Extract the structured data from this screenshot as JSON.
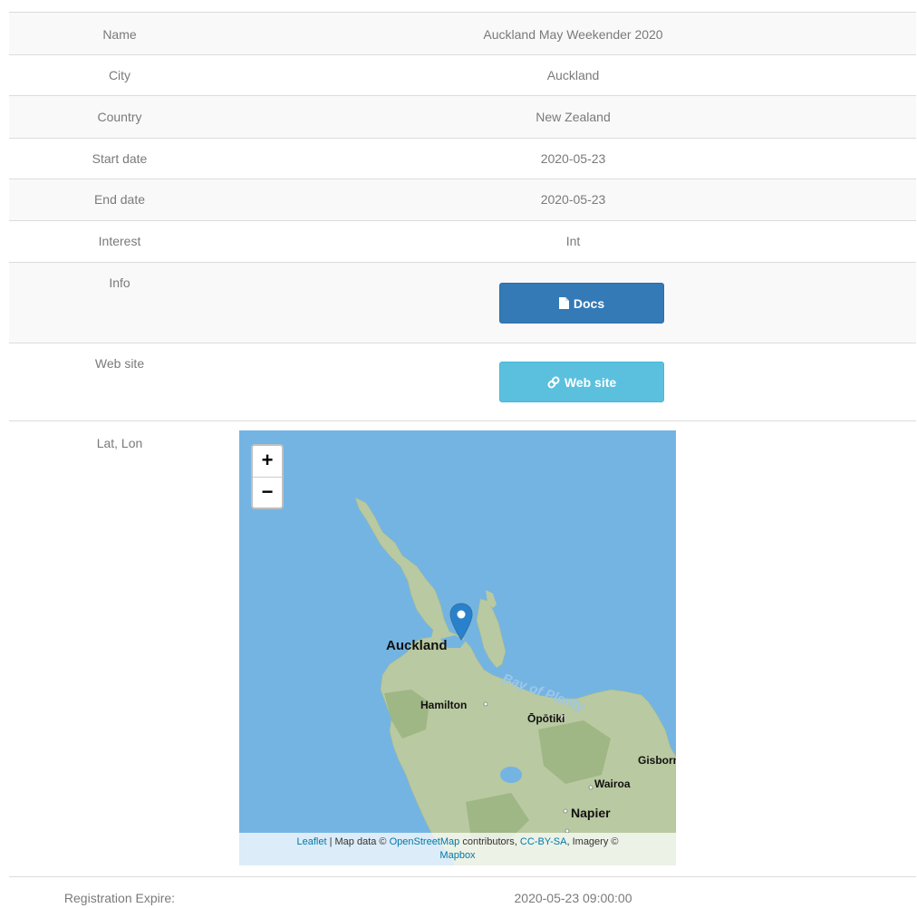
{
  "rows": [
    {
      "label": "Name",
      "value": "Auckland May Weekender 2020"
    },
    {
      "label": "City",
      "value": "Auckland"
    },
    {
      "label": "Country",
      "value": "New Zealand"
    },
    {
      "label": "Start date",
      "value": "2020-05-23"
    },
    {
      "label": "End date",
      "value": "2020-05-23"
    },
    {
      "label": "Interest",
      "value": "Int"
    }
  ],
  "info": {
    "label": "Info",
    "button": "Docs",
    "icon": "document-icon"
  },
  "website": {
    "label": "Web site",
    "button": "Web site",
    "icon": "link-icon"
  },
  "latlon": {
    "label": "Lat, Lon"
  },
  "map": {
    "zoom_in": "+",
    "zoom_out": "−",
    "cities": [
      "Auckland",
      "Hamilton",
      "Ōpōtiki",
      "Gisborne",
      "Wairoa",
      "Napier"
    ],
    "sea_label": "Bay of Plenty",
    "attribution": {
      "leaflet": "Leaflet",
      "map_data": "| Map data ©",
      "osm": "OpenStreetMap",
      "contributors": "contributors,",
      "license": "CC-BY-SA",
      "imagery": ", Imagery ©",
      "mapbox": "Mapbox"
    },
    "marker_color": "#2a81cb"
  },
  "registration": {
    "label": "Registration Expire:",
    "value": "2020-05-23 09:00:00"
  },
  "colors": {
    "primary": "#337ab7",
    "info": "#5bc0de",
    "sea": "#74b4e3",
    "land": "#b7c9a0"
  }
}
